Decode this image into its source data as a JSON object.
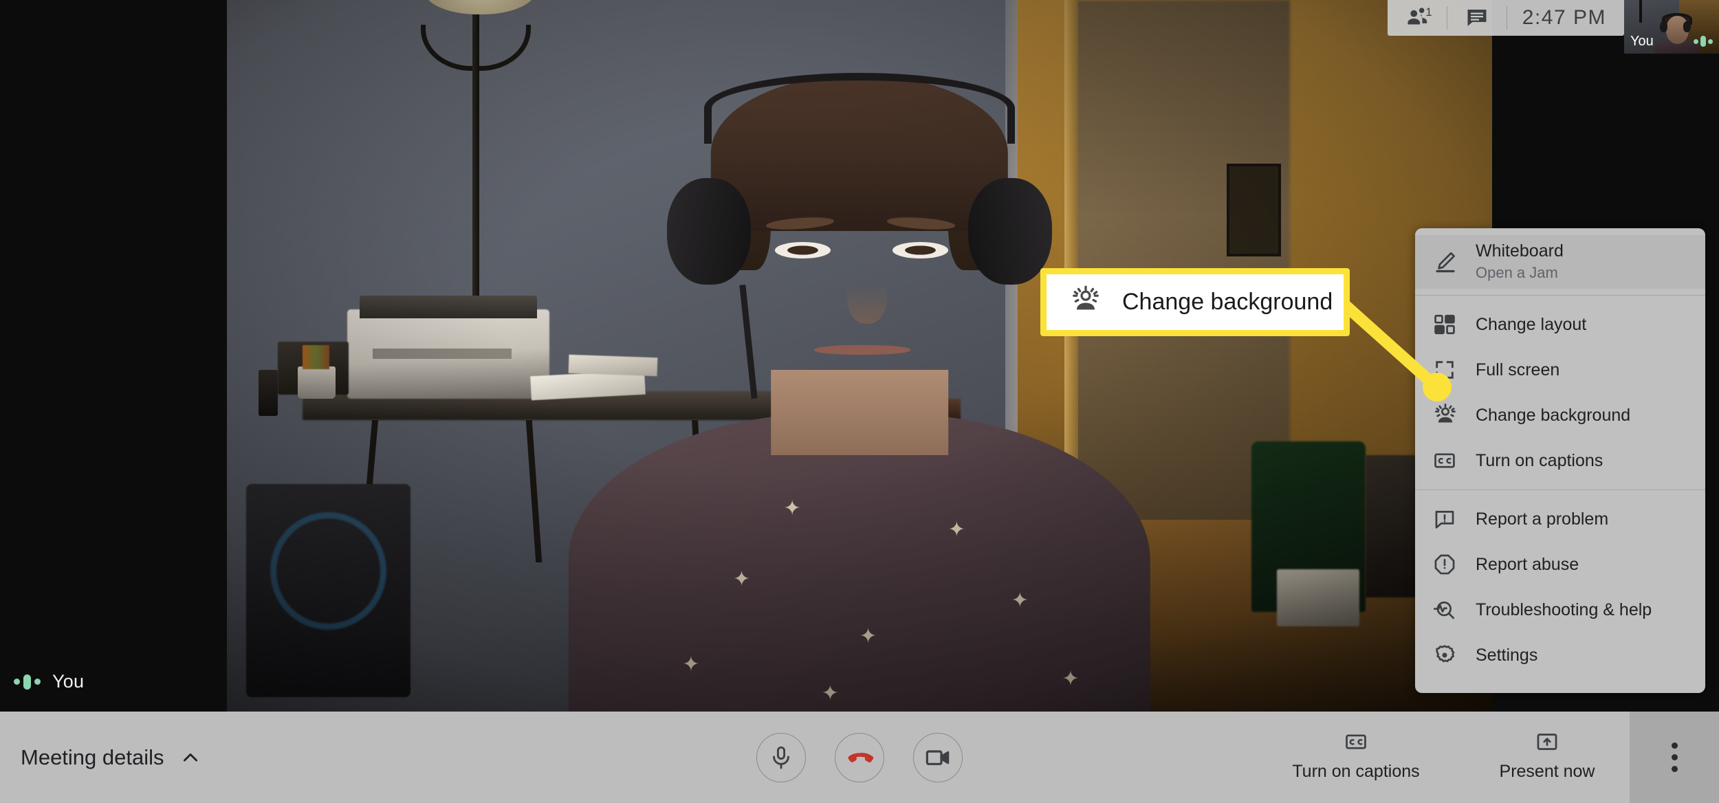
{
  "app": {
    "name": "Google Meet"
  },
  "header": {
    "participants_icon": "people-icon",
    "participants_count": "1",
    "chat_icon": "chat-icon",
    "clock": "2:47  PM"
  },
  "self_view": {
    "label": "You",
    "audio_indicator": "audio-level-icon"
  },
  "stage": {
    "participant_label": "You",
    "audio_indicator": "audio-level-icon"
  },
  "callout": {
    "icon": "change-background-icon",
    "text": "Change background",
    "border_color": "#fbe23a",
    "background_color": "#ffffff"
  },
  "menu": {
    "items": [
      {
        "icon": "pencil-icon",
        "label": "Whiteboard",
        "sub": "Open a Jam"
      },
      {
        "icon": "layout-icon",
        "label": "Change layout",
        "sub": ""
      },
      {
        "icon": "fullscreen-icon",
        "label": "Full screen",
        "sub": ""
      },
      {
        "icon": "change-background-icon",
        "label": "Change background",
        "sub": ""
      },
      {
        "icon": "closed-caption-icon",
        "label": "Turn on captions",
        "sub": ""
      },
      {
        "icon": "report-problem-icon",
        "label": "Report a problem",
        "sub": ""
      },
      {
        "icon": "report-abuse-icon",
        "label": "Report abuse",
        "sub": ""
      },
      {
        "icon": "troubleshooting-icon",
        "label": "Troubleshooting & help",
        "sub": ""
      },
      {
        "icon": "gear-icon",
        "label": "Settings",
        "sub": ""
      }
    ]
  },
  "bottom_bar": {
    "meeting_details_label": "Meeting details",
    "meeting_details_chevron": "chevron-up-icon",
    "mic_button": "microphone-icon",
    "hangup_button": "end-call-icon",
    "camera_button": "video-camera-icon",
    "hangup_color": "#c5342a",
    "captions_label": "Turn on captions",
    "captions_icon": "closed-caption-icon",
    "present_label": "Present now",
    "present_icon": "present-screen-icon",
    "more_options": "more-vertical-icon"
  }
}
